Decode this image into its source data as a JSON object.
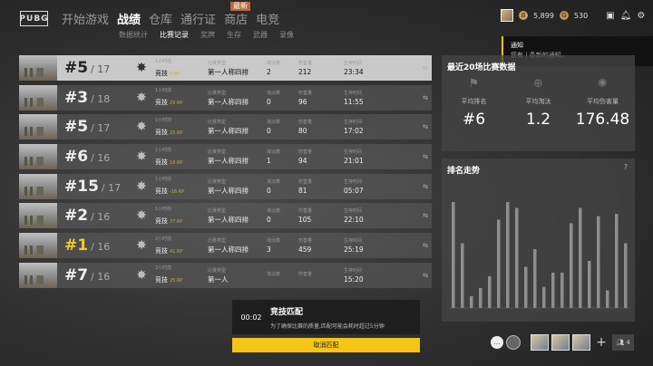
{
  "app": {
    "logo": "PUBG"
  },
  "nav": {
    "items": [
      {
        "label": "开始游戏",
        "active": false
      },
      {
        "label": "战绩",
        "active": true
      },
      {
        "label": "仓库",
        "active": false
      },
      {
        "label": "通行证",
        "active": false
      },
      {
        "label": "商店",
        "active": false
      },
      {
        "label": "电竞",
        "active": false
      }
    ],
    "new_badge": "最新"
  },
  "subnav": {
    "items": [
      {
        "label": "数据统计",
        "active": false
      },
      {
        "label": "比赛记录",
        "active": true
      },
      {
        "label": "奖牌",
        "active": false
      },
      {
        "label": "生存",
        "active": false
      },
      {
        "label": "武器",
        "active": false
      },
      {
        "label": "录像",
        "active": false
      }
    ]
  },
  "currency": {
    "bp": "5,899",
    "g": "530",
    "bp_icon": "bp-coin-icon",
    "g_icon": "g-coin-icon"
  },
  "notification": {
    "title": "通知",
    "message": "您有 | 条新的通知。"
  },
  "matches": [
    {
      "rank": "#5",
      "total": "/ 17",
      "time": "1小时前",
      "mode": "竞技",
      "rp": "0 RP",
      "type": "第一人称四排",
      "kills": "2",
      "damage": "212",
      "survival": "23:34",
      "selected": true,
      "win": false
    },
    {
      "rank": "#3",
      "total": "/ 18",
      "time": "1小时前",
      "mode": "竞技",
      "rp": "29 RP",
      "type": "第一人称四排",
      "kills": "0",
      "damage": "96",
      "survival": "11:55",
      "selected": false,
      "win": false
    },
    {
      "rank": "#5",
      "total": "/ 17",
      "time": "1小时前",
      "mode": "竞技",
      "rp": "25 RP",
      "type": "第一人称四排",
      "kills": "0",
      "damage": "80",
      "survival": "17:02",
      "selected": false,
      "win": false
    },
    {
      "rank": "#6",
      "total": "/ 16",
      "time": "1小时前",
      "mode": "竞技",
      "rp": "18 RP",
      "type": "第一人称四排",
      "kills": "1",
      "damage": "94",
      "survival": "21:01",
      "selected": false,
      "win": false
    },
    {
      "rank": "#15",
      "total": "/ 17",
      "time": "1小时前",
      "mode": "竞技",
      "rp": "-16 RP",
      "type": "第一人称四排",
      "kills": "0",
      "damage": "81",
      "survival": "05:07",
      "selected": false,
      "win": false
    },
    {
      "rank": "#2",
      "total": "/ 16",
      "time": "1小时前",
      "mode": "竞技",
      "rp": "37 RP",
      "type": "第一人称四排",
      "kills": "0",
      "damage": "105",
      "survival": "22:10",
      "selected": false,
      "win": false
    },
    {
      "rank": "#1",
      "total": "/ 16",
      "time": "2小时前",
      "mode": "竞技",
      "rp": "41 RP",
      "type": "第一人称四排",
      "kills": "3",
      "damage": "459",
      "survival": "25:19",
      "selected": false,
      "win": true
    },
    {
      "rank": "#7",
      "total": "/ 16",
      "time": "2小时前",
      "mode": "竞技",
      "rp": "25 RP",
      "type": "第一人",
      "kills": "",
      "damage": "",
      "survival": "15:20",
      "selected": false,
      "win": false
    }
  ],
  "column_headers": {
    "type": "比赛类型",
    "kills": "淘汰数",
    "damage": "伤害量",
    "survival": "生存时间"
  },
  "summary": {
    "title": "最近20场比赛数据",
    "stats": [
      {
        "label": "平均排名",
        "value": "#6",
        "icon": "flag-icon"
      },
      {
        "label": "平均淘汰",
        "value": "1.2",
        "icon": "crosshair-icon"
      },
      {
        "label": "平均伤害量",
        "value": "176.48",
        "icon": "explosion-icon"
      }
    ]
  },
  "trend": {
    "title": "排名走势",
    "rank_levels": [
      0.9,
      0.55,
      0.1,
      0.17,
      0.27,
      0.75,
      0.9,
      0.85,
      0.35,
      0.5,
      0.18,
      0.3,
      0.3,
      0.72,
      0.85,
      0.4,
      0.78,
      0.15,
      0.8,
      0.55
    ]
  },
  "matchmaking": {
    "timer": "00:02",
    "title": "竞技匹配",
    "subtitle": "为了确保比赛的质量,匹配可能会耗时超过5分钟",
    "cancel_label": "取消匹配"
  },
  "party": {
    "count": "4"
  }
}
